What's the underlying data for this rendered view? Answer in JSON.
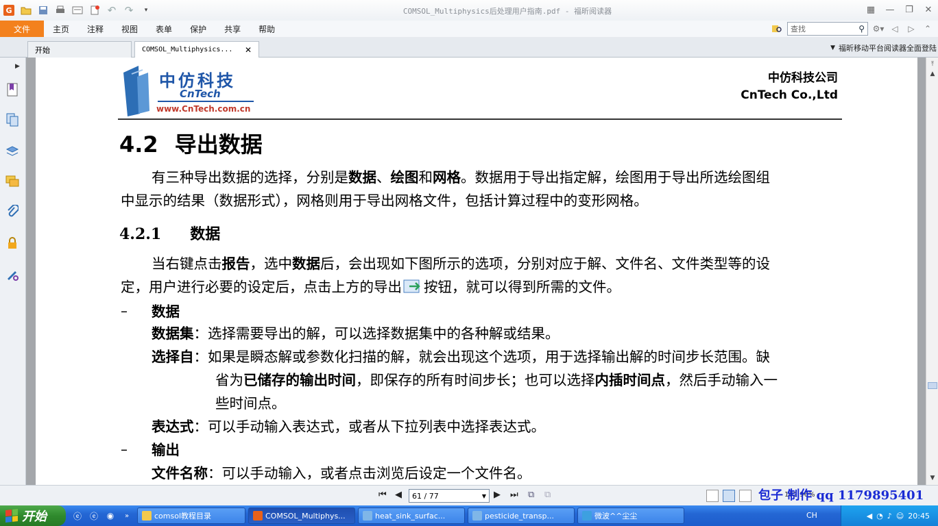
{
  "window": {
    "title": "COMSOL_Multiphysics后处理用户指南.pdf - 福昕阅读器"
  },
  "menu": {
    "file": "文件",
    "items": [
      "主页",
      "注释",
      "视图",
      "表单",
      "保护",
      "共享",
      "帮助"
    ],
    "search_placeholder": "查找"
  },
  "tabs": {
    "start": "开始",
    "document": "COMSOL_Multiphysics..."
  },
  "promo": "福昕移动平台阅读器全面登陆",
  "doc": {
    "logo_cn": "中仿科技",
    "logo_en": "CnTech",
    "logo_url": "www.CnTech.com.cn",
    "company_cn": "中仿科技公司",
    "company_en": "CnTech Co.,Ltd",
    "section_num": "4.2",
    "section_title": "导出数据",
    "p1_a": "有三种导出数据的选择，分别是",
    "p1_b1": "数据",
    "p1_c": "、",
    "p1_b2": "绘图",
    "p1_d": "和",
    "p1_b3": "网格",
    "p1_e": "。数据用于导出指定解，绘图用于导出所选绘图组",
    "p1_line2": "中显示的结果（数据形式），网格则用于导出网格文件，包括计算过程中的变形网格。",
    "sub_num": "4.2.1",
    "sub_title": "数据",
    "p2_a": "当右键点击",
    "p2_b1": "报告",
    "p2_c": "，选中",
    "p2_b2": "数据",
    "p2_d": "后，会出现如下图所示的选项，分别对应于解、文件名、文件类型等的设",
    "p2_line2a": "定，用户进行必要的设定后，点击上方的导出",
    "p2_line2b": "按钮，就可以得到所需的文件。",
    "dash": "–",
    "b1_head": "数据",
    "dataset_label": "数据集",
    "dataset_text": "：选择需要导出的解，可以选择数据集中的各种解或结果。",
    "from_label": "选择自",
    "from_text": "：如果是瞬态解或参数化扫描的解，就会出现这个选项，用于选择输出解的时间步长范围。缺",
    "from_line2a": "省为",
    "from_line2b": "已储存的输出时间",
    "from_line2c": "，即保存的所有时间步长；也可以选择",
    "from_line2d": "内插时间点",
    "from_line2e": "，然后手动输入一",
    "from_line3": "些时间点。",
    "expr_label": "表达式",
    "expr_text": "：可以手动输入表达式，或者从下拉列表中选择表达式。",
    "b2_head": "输出",
    "filename_label": "文件名称",
    "filename_text": "：可以手动输入，或者点击浏览后设定一个文件名。"
  },
  "status": {
    "page": "61 / 77",
    "zoom": "162.96%",
    "watermark": "包子 制作  qq 1179895401"
  },
  "taskbar": {
    "start": "开始",
    "tasks": [
      {
        "label": "comsol教程目录",
        "color": "#f2c94c"
      },
      {
        "label": "COMSOL_Multiphys...",
        "color": "#e8611a"
      },
      {
        "label": "heat_sink_surfac...",
        "color": "#7fb6e8"
      },
      {
        "label": "pesticide_transp...",
        "color": "#7fb6e8"
      },
      {
        "label": "微波^^尘尘",
        "color": "#3da0e0"
      }
    ],
    "lang": "CH",
    "clock": "20:45"
  },
  "colors": {
    "accent": "#f3811d",
    "link_blue": "#1a2bd4"
  }
}
